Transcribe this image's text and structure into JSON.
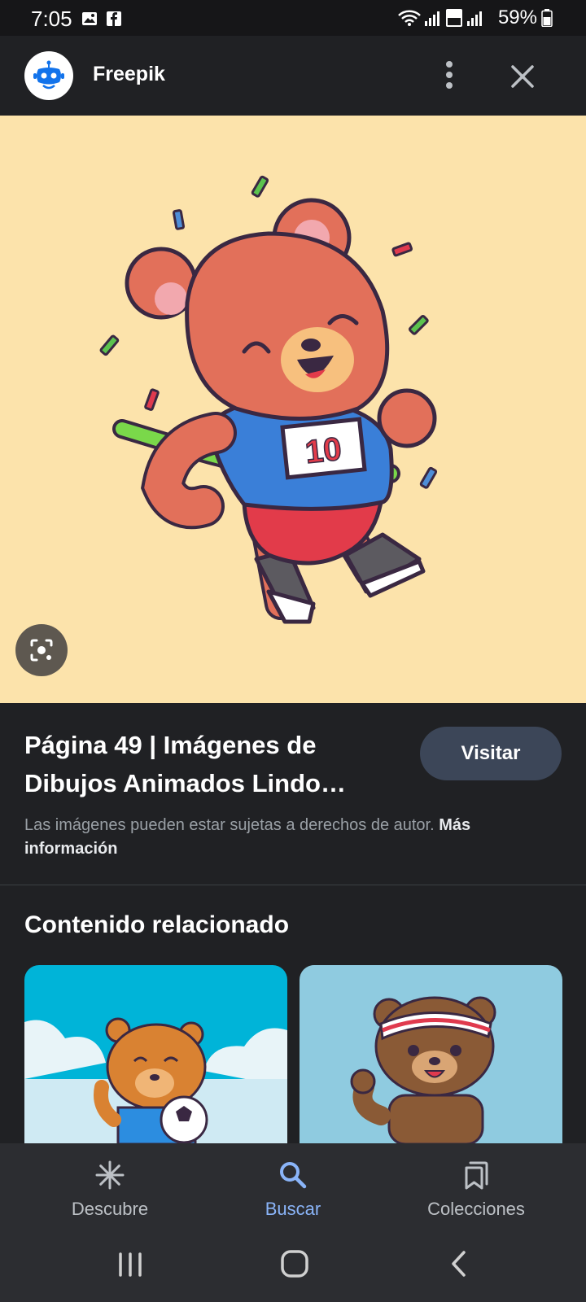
{
  "status_bar": {
    "time": "7:05",
    "battery": "59%",
    "icons": [
      "image-notification-icon",
      "facebook-icon",
      "wifi-icon",
      "signal-icon",
      "volte-icon",
      "signal-icon",
      "battery-icon"
    ]
  },
  "header": {
    "source_name": "Freepik",
    "icons": [
      "freepik-logo",
      "more-vert-icon",
      "close-icon"
    ]
  },
  "preview": {
    "lens_icon": "google-lens-icon"
  },
  "result": {
    "title": "Página 49 | Imágenes de Dibujos Animados Lindo…",
    "visit_label": "Visitar",
    "copyright_text": "Las imágenes pueden estar sujetas a derechos de autor.",
    "more_info_link": "Más información"
  },
  "related": {
    "heading": "Contenido relacionado"
  },
  "bottom_nav": {
    "items": [
      {
        "label": "Descubre",
        "icon": "asterisk-icon",
        "active": false
      },
      {
        "label": "Buscar",
        "icon": "search-icon",
        "active": true
      },
      {
        "label": "Colecciones",
        "icon": "collections-icon",
        "active": false
      }
    ]
  },
  "colors": {
    "background": "#202124",
    "preview_bg": "#fce3ab",
    "accent": "#8ab4f8",
    "visit_button": "#3c4658"
  }
}
